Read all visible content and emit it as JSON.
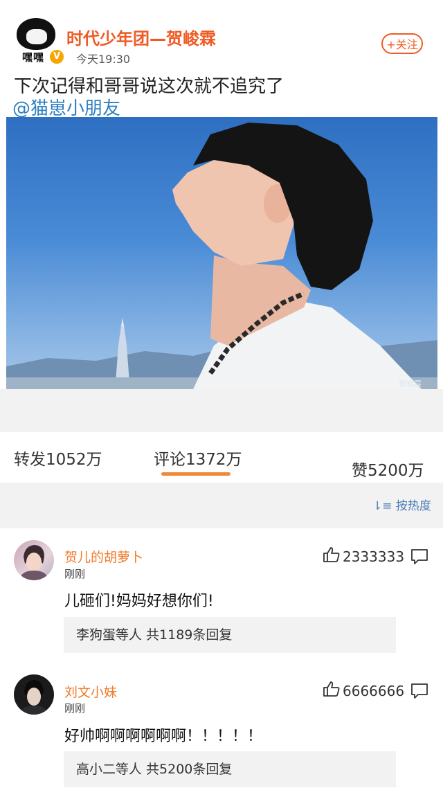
{
  "post": {
    "author": "时代少年团—贺峻霖",
    "avatar_text": "嘿嘿",
    "verified_badge": "V",
    "time": "今天19:30",
    "follow_label": "+关注",
    "text": "下次记得和哥哥说这次就不追究了",
    "mention": "@猫崽小朋友",
    "image_watermark": "贺峻霖"
  },
  "stats": {
    "repost": "转发1052万",
    "comment": "评论1372万",
    "like": "赞5200万"
  },
  "sort_label": "按热度",
  "comments": [
    {
      "name": "贺儿的胡萝卜",
      "time": "刚刚",
      "likes": "2333333",
      "text": "儿砸们!妈妈好想你们!",
      "reply": "李狗蛋等人 共1189条回复"
    },
    {
      "name": "刘文小妹",
      "time": "刚刚",
      "likes": "6666666",
      "text": "好帅啊啊啊啊啊啊！！！！！",
      "reply": "高小二等人 共5200条回复"
    }
  ],
  "colors": {
    "accent": "#f05a24",
    "link": "#2d7fc1",
    "tab_underline": "#f08a3a",
    "background_gray": "#f2f2f2"
  }
}
